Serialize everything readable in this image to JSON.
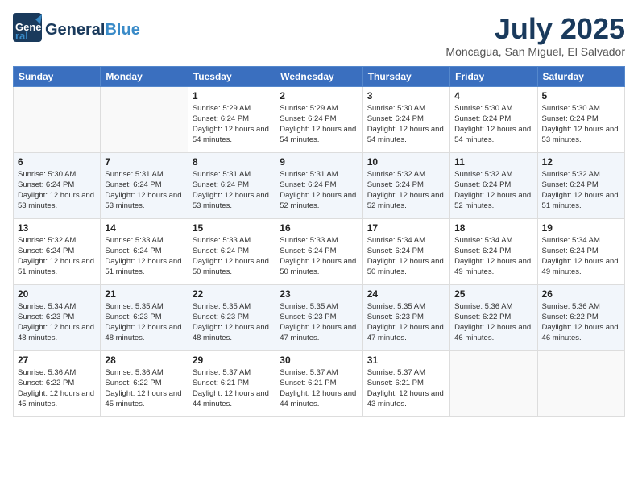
{
  "header": {
    "logo_line1": "General",
    "logo_line2": "Blue",
    "month": "July 2025",
    "location": "Moncagua, San Miguel, El Salvador"
  },
  "weekdays": [
    "Sunday",
    "Monday",
    "Tuesday",
    "Wednesday",
    "Thursday",
    "Friday",
    "Saturday"
  ],
  "weeks": [
    [
      {
        "day": "",
        "sunrise": "",
        "sunset": "",
        "daylight": ""
      },
      {
        "day": "",
        "sunrise": "",
        "sunset": "",
        "daylight": ""
      },
      {
        "day": "1",
        "sunrise": "Sunrise: 5:29 AM",
        "sunset": "Sunset: 6:24 PM",
        "daylight": "Daylight: 12 hours and 54 minutes."
      },
      {
        "day": "2",
        "sunrise": "Sunrise: 5:29 AM",
        "sunset": "Sunset: 6:24 PM",
        "daylight": "Daylight: 12 hours and 54 minutes."
      },
      {
        "day": "3",
        "sunrise": "Sunrise: 5:30 AM",
        "sunset": "Sunset: 6:24 PM",
        "daylight": "Daylight: 12 hours and 54 minutes."
      },
      {
        "day": "4",
        "sunrise": "Sunrise: 5:30 AM",
        "sunset": "Sunset: 6:24 PM",
        "daylight": "Daylight: 12 hours and 54 minutes."
      },
      {
        "day": "5",
        "sunrise": "Sunrise: 5:30 AM",
        "sunset": "Sunset: 6:24 PM",
        "daylight": "Daylight: 12 hours and 53 minutes."
      }
    ],
    [
      {
        "day": "6",
        "sunrise": "Sunrise: 5:30 AM",
        "sunset": "Sunset: 6:24 PM",
        "daylight": "Daylight: 12 hours and 53 minutes."
      },
      {
        "day": "7",
        "sunrise": "Sunrise: 5:31 AM",
        "sunset": "Sunset: 6:24 PM",
        "daylight": "Daylight: 12 hours and 53 minutes."
      },
      {
        "day": "8",
        "sunrise": "Sunrise: 5:31 AM",
        "sunset": "Sunset: 6:24 PM",
        "daylight": "Daylight: 12 hours and 53 minutes."
      },
      {
        "day": "9",
        "sunrise": "Sunrise: 5:31 AM",
        "sunset": "Sunset: 6:24 PM",
        "daylight": "Daylight: 12 hours and 52 minutes."
      },
      {
        "day": "10",
        "sunrise": "Sunrise: 5:32 AM",
        "sunset": "Sunset: 6:24 PM",
        "daylight": "Daylight: 12 hours and 52 minutes."
      },
      {
        "day": "11",
        "sunrise": "Sunrise: 5:32 AM",
        "sunset": "Sunset: 6:24 PM",
        "daylight": "Daylight: 12 hours and 52 minutes."
      },
      {
        "day": "12",
        "sunrise": "Sunrise: 5:32 AM",
        "sunset": "Sunset: 6:24 PM",
        "daylight": "Daylight: 12 hours and 51 minutes."
      }
    ],
    [
      {
        "day": "13",
        "sunrise": "Sunrise: 5:32 AM",
        "sunset": "Sunset: 6:24 PM",
        "daylight": "Daylight: 12 hours and 51 minutes."
      },
      {
        "day": "14",
        "sunrise": "Sunrise: 5:33 AM",
        "sunset": "Sunset: 6:24 PM",
        "daylight": "Daylight: 12 hours and 51 minutes."
      },
      {
        "day": "15",
        "sunrise": "Sunrise: 5:33 AM",
        "sunset": "Sunset: 6:24 PM",
        "daylight": "Daylight: 12 hours and 50 minutes."
      },
      {
        "day": "16",
        "sunrise": "Sunrise: 5:33 AM",
        "sunset": "Sunset: 6:24 PM",
        "daylight": "Daylight: 12 hours and 50 minutes."
      },
      {
        "day": "17",
        "sunrise": "Sunrise: 5:34 AM",
        "sunset": "Sunset: 6:24 PM",
        "daylight": "Daylight: 12 hours and 50 minutes."
      },
      {
        "day": "18",
        "sunrise": "Sunrise: 5:34 AM",
        "sunset": "Sunset: 6:24 PM",
        "daylight": "Daylight: 12 hours and 49 minutes."
      },
      {
        "day": "19",
        "sunrise": "Sunrise: 5:34 AM",
        "sunset": "Sunset: 6:24 PM",
        "daylight": "Daylight: 12 hours and 49 minutes."
      }
    ],
    [
      {
        "day": "20",
        "sunrise": "Sunrise: 5:34 AM",
        "sunset": "Sunset: 6:23 PM",
        "daylight": "Daylight: 12 hours and 48 minutes."
      },
      {
        "day": "21",
        "sunrise": "Sunrise: 5:35 AM",
        "sunset": "Sunset: 6:23 PM",
        "daylight": "Daylight: 12 hours and 48 minutes."
      },
      {
        "day": "22",
        "sunrise": "Sunrise: 5:35 AM",
        "sunset": "Sunset: 6:23 PM",
        "daylight": "Daylight: 12 hours and 48 minutes."
      },
      {
        "day": "23",
        "sunrise": "Sunrise: 5:35 AM",
        "sunset": "Sunset: 6:23 PM",
        "daylight": "Daylight: 12 hours and 47 minutes."
      },
      {
        "day": "24",
        "sunrise": "Sunrise: 5:35 AM",
        "sunset": "Sunset: 6:23 PM",
        "daylight": "Daylight: 12 hours and 47 minutes."
      },
      {
        "day": "25",
        "sunrise": "Sunrise: 5:36 AM",
        "sunset": "Sunset: 6:22 PM",
        "daylight": "Daylight: 12 hours and 46 minutes."
      },
      {
        "day": "26",
        "sunrise": "Sunrise: 5:36 AM",
        "sunset": "Sunset: 6:22 PM",
        "daylight": "Daylight: 12 hours and 46 minutes."
      }
    ],
    [
      {
        "day": "27",
        "sunrise": "Sunrise: 5:36 AM",
        "sunset": "Sunset: 6:22 PM",
        "daylight": "Daylight: 12 hours and 45 minutes."
      },
      {
        "day": "28",
        "sunrise": "Sunrise: 5:36 AM",
        "sunset": "Sunset: 6:22 PM",
        "daylight": "Daylight: 12 hours and 45 minutes."
      },
      {
        "day": "29",
        "sunrise": "Sunrise: 5:37 AM",
        "sunset": "Sunset: 6:21 PM",
        "daylight": "Daylight: 12 hours and 44 minutes."
      },
      {
        "day": "30",
        "sunrise": "Sunrise: 5:37 AM",
        "sunset": "Sunset: 6:21 PM",
        "daylight": "Daylight: 12 hours and 44 minutes."
      },
      {
        "day": "31",
        "sunrise": "Sunrise: 5:37 AM",
        "sunset": "Sunset: 6:21 PM",
        "daylight": "Daylight: 12 hours and 43 minutes."
      },
      {
        "day": "",
        "sunrise": "",
        "sunset": "",
        "daylight": ""
      },
      {
        "day": "",
        "sunrise": "",
        "sunset": "",
        "daylight": ""
      }
    ]
  ]
}
